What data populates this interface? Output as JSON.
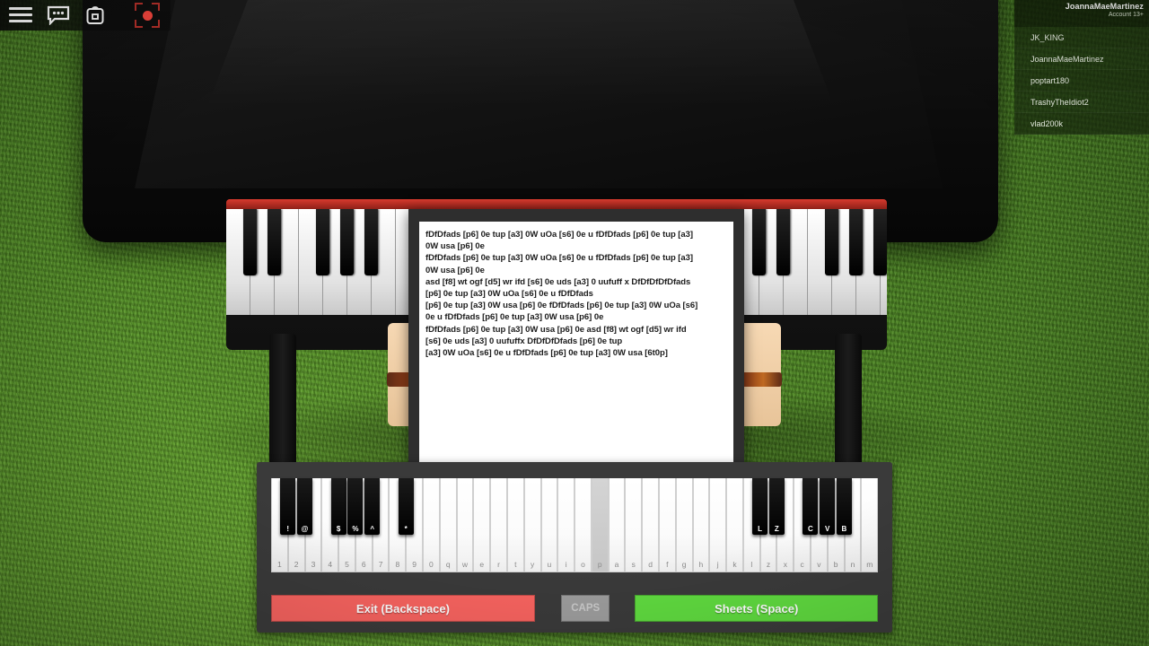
{
  "topbar": {
    "menu_icon": "hamburger-menu-icon",
    "chat_icon": "chat-bubble-icon",
    "backpack_icon": "backpack-icon",
    "record_icon": "record-capture-icon"
  },
  "player_list": {
    "account_name": "JoannaMaeMartinez",
    "account_type": "Account 13+",
    "players": [
      "JK_KING",
      "JoannaMaeMartinez",
      "poptart180",
      "TrashyTheIdiot2",
      "vlad200k"
    ]
  },
  "sheet": {
    "lines": [
      "fDfDfads [p6] 0e tup [a3] 0W uOa [s6] 0e u fDfDfads [p6] 0e tup [a3]",
      "0W usa [p6] 0e",
      "fDfDfads [p6] 0e tup [a3] 0W uOa [s6] 0e u fDfDfads [p6] 0e tup [a3]",
      "0W usa [p6] 0e",
      "asd [f8] wt ogf [d5] wr ifd [s6] 0e uds [a3] 0 uufuff x DfDfDfDfDfads",
      "[p6] 0e tup [a3] 0W uOa [s6] 0e u fDfDfads",
      "[p6] 0e tup [a3] 0W usa [p6] 0e fDfDfads [p6] 0e tup [a3] 0W uOa [s6]",
      "0e u fDfDfads [p6] 0e tup [a3] 0W usa [p6] 0e",
      "fDfDfads [p6] 0e tup [a3] 0W usa [p6] 0e asd [f8] wt ogf [d5] wr ifd",
      "[s6] 0e uds [a3] 0 uufuffx DfDfDfDfads [p6] 0e tup",
      "[a3] 0W uOa [s6] 0e u fDfDfads [p6] 0e tup [a3] 0W usa [6t0p]"
    ]
  },
  "keyboard": {
    "white_keys": [
      "1",
      "2",
      "3",
      "4",
      "5",
      "6",
      "7",
      "8",
      "9",
      "0",
      "q",
      "w",
      "e",
      "r",
      "t",
      "y",
      "u",
      "i",
      "o",
      "p",
      "a",
      "s",
      "d",
      "f",
      "g",
      "h",
      "j",
      "k",
      "l",
      "z",
      "x",
      "c",
      "v",
      "b",
      "n",
      "m"
    ],
    "active_white_key": "p",
    "black_keys": [
      {
        "label": "!",
        "after_index": 0
      },
      {
        "label": "@",
        "after_index": 1
      },
      {
        "label": "$",
        "after_index": 3
      },
      {
        "label": "%",
        "after_index": 4
      },
      {
        "label": "^",
        "after_index": 5
      },
      {
        "label": "*",
        "after_index": 7
      },
      {
        "label": "L",
        "after_index": 28
      },
      {
        "label": "Z",
        "after_index": 29
      },
      {
        "label": "C",
        "after_index": 31
      },
      {
        "label": "V",
        "after_index": 32
      },
      {
        "label": "B",
        "after_index": 33
      }
    ]
  },
  "buttons": {
    "exit": "Exit (Backspace)",
    "caps": "CAPS",
    "sheets": "Sheets (Space)"
  },
  "colors": {
    "exit": "#f7635f",
    "sheets": "#5fd93f",
    "caps": "#9c9c9c",
    "panel": "#3a3a3a",
    "record": "#f2453d"
  }
}
